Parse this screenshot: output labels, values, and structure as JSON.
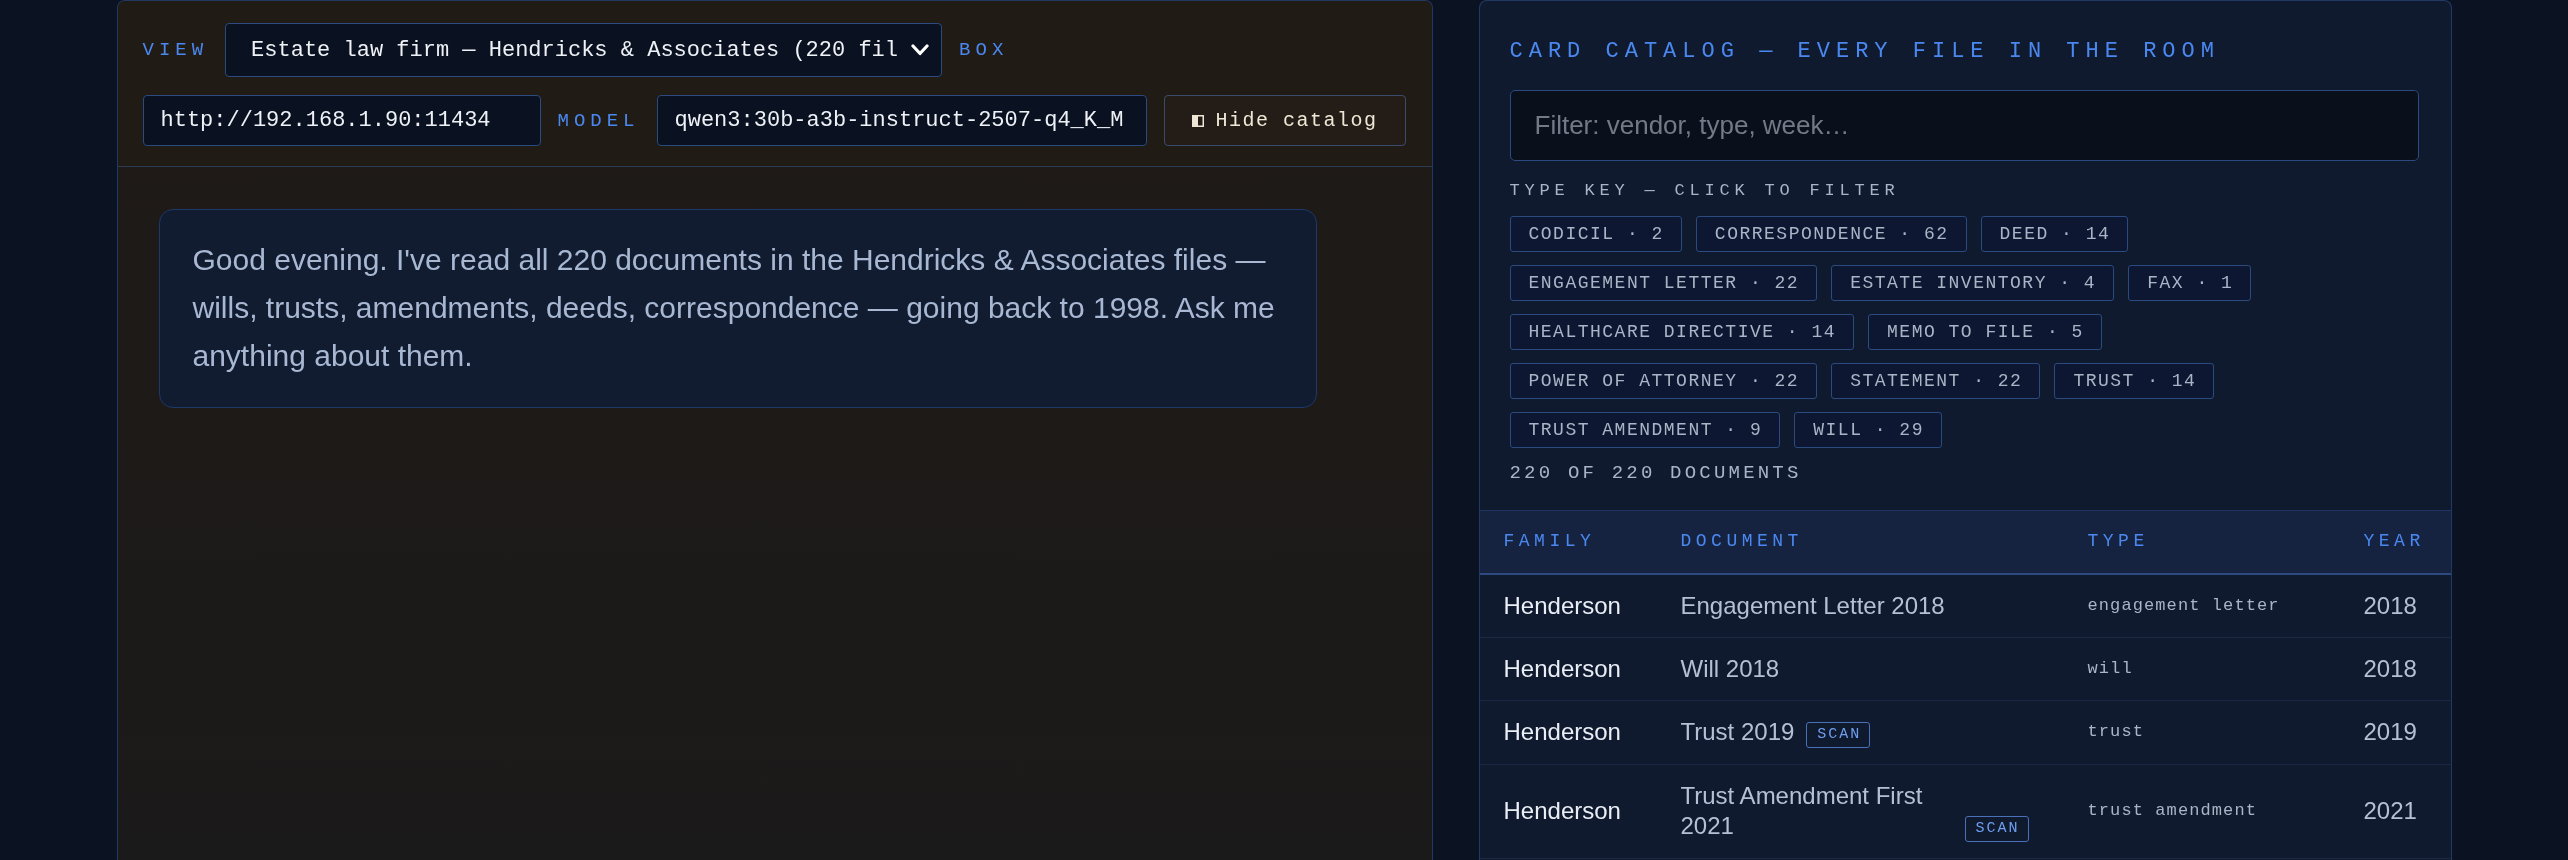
{
  "chat_panel": {
    "toolbar": {
      "view_label": "VIEW",
      "view_select": {
        "value": "Estate law firm — Hendricks & Associates (220 fil"
      },
      "box_label": "BOX",
      "host_field": {
        "value": "http://192.168.1.90:11434"
      },
      "model_label": "MODEL",
      "model_field": {
        "value": "qwen3:30b-a3b-instruct-2507-q4_K_M"
      },
      "catalog_button": {
        "label": "Hide catalog"
      }
    },
    "messages": [
      {
        "text": "Good evening. I've read all 220 documents in the Hendricks & Associates files — wills, trusts, amendments, deeds, correspondence — going back to 1998. Ask me anything about them."
      }
    ]
  },
  "catalog": {
    "title": "CARD CATALOG — EVERY FILE IN THE ROOM",
    "filter": {
      "placeholder": "Filter: vendor, type, week…"
    },
    "type_key": {
      "heading": "TYPE KEY — CLICK TO FILTER",
      "chips": [
        {
          "label": "CODICIL · 2",
          "selected": false
        },
        {
          "label": "CORRESPONDENCE · 62",
          "selected": false
        },
        {
          "label": "DEED · 14",
          "selected": false
        },
        {
          "label": "ENGAGEMENT LETTER · 22",
          "selected": false
        },
        {
          "label": "ESTATE INVENTORY · 4",
          "selected": false
        },
        {
          "label": "FAX · 1",
          "selected": false
        },
        {
          "label": "HEALTHCARE DIRECTIVE · 14",
          "selected": false
        },
        {
          "label": "MEMO TO FILE · 5",
          "selected": false
        },
        {
          "label": "POWER OF ATTORNEY · 22",
          "selected": false
        },
        {
          "label": "STATEMENT · 22",
          "selected": false
        },
        {
          "label": "TRUST · 14",
          "selected": false
        },
        {
          "label": "TRUST AMENDMENT · 9",
          "selected": false
        },
        {
          "label": "WILL · 29",
          "selected": false
        }
      ]
    },
    "count": "220 OF 220 DOCUMENTS",
    "table": {
      "columns": [
        "FAMILY",
        "DOCUMENT",
        "TYPE",
        "YEAR"
      ],
      "rows": [
        {
          "family": "Henderson",
          "document": "Engagement Letter 2018",
          "type": "engagement letter",
          "year": "2018"
        },
        {
          "family": "Henderson",
          "document": "Will 2018",
          "type": "will",
          "year": "2018"
        },
        {
          "family": "Henderson",
          "document": "Trust 2019",
          "badge": "SCAN",
          "type": "trust",
          "year": "2019"
        },
        {
          "family": "Henderson",
          "document": "Trust Amendment First 2021",
          "badge": "SCAN",
          "type": "trust amendment",
          "year": "2021"
        }
      ]
    }
  }
}
